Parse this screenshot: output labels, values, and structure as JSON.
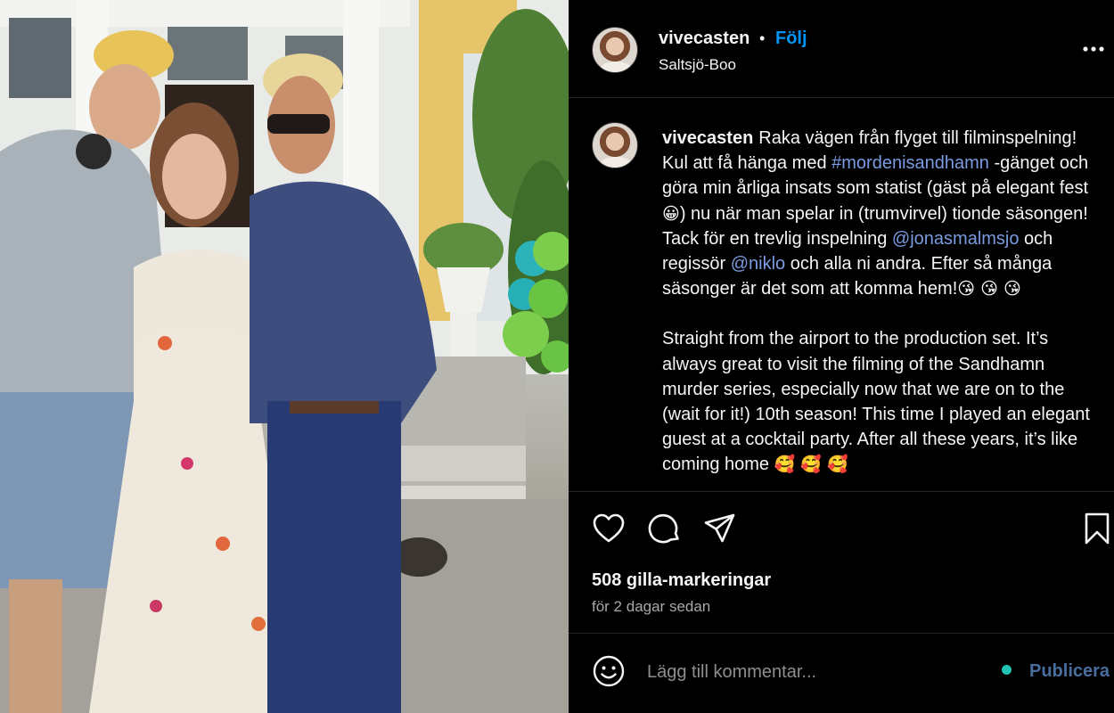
{
  "post": {
    "username": "vivecasten",
    "separator": "•",
    "follow_label": "Följ",
    "location": "Saltsjö-Boo"
  },
  "caption": {
    "username": "vivecasten",
    "seg1": "Raka vägen från flyget till filminspelning! Kul att få hänga med ",
    "hashtag": "#mordenisandhamn",
    "seg2": " -gänget och göra min årliga insats som statist (gäst på elegant fest",
    "emoji_grin": "😀",
    "seg3": ") nu när man spelar in (trumvirvel) tionde säsongen! Tack för en trevlig inspelning ",
    "mention1": "@jonasmalmsjo",
    "seg4": " och regissör ",
    "mention2": "@niklo",
    "seg5": " och alla ni andra. Efter så många säsonger är det som att komma hem!",
    "emoji_kiss": "😘 😘 😘",
    "english": "Straight from the airport to the production set. It’s always great to visit the filming of the Sandhamn murder series, especially now that we are on to the (wait for it!) 10th season! This time I played an elegant guest at a cocktail party. After all these years, it’s like coming home",
    "emoji_love": "🥰 🥰 🥰"
  },
  "stats": {
    "likes": "508 gilla-markeringar",
    "time": "för 2 dagar sedan"
  },
  "comment": {
    "placeholder": "Lägg till kommentar...",
    "publish_label": "Publicera"
  },
  "icons": {
    "more": "more-options-icon",
    "like": "heart-icon",
    "comment": "comment-icon",
    "share": "share-icon",
    "save": "bookmark-icon",
    "emoji": "smiley-icon"
  },
  "colors": {
    "background": "#000000",
    "follow": "#0095f6",
    "link": "#7b9be0",
    "publish": "#4a6d9f"
  }
}
